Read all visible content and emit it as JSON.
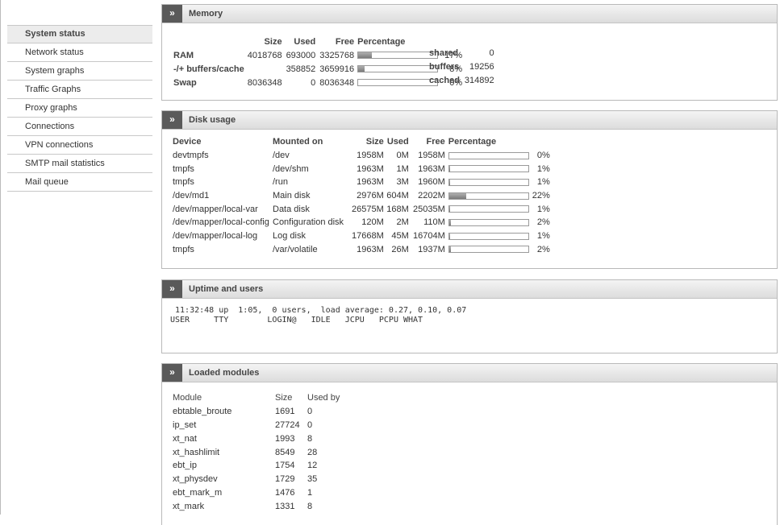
{
  "sidebar": {
    "items": [
      {
        "label": "System status"
      },
      {
        "label": "Network status"
      },
      {
        "label": "System graphs"
      },
      {
        "label": "Traffic Graphs"
      },
      {
        "label": "Proxy graphs"
      },
      {
        "label": "Connections"
      },
      {
        "label": "VPN connections"
      },
      {
        "label": "SMTP mail statistics"
      },
      {
        "label": "Mail queue"
      }
    ]
  },
  "toggle_glyph": "»",
  "memory": {
    "title": "Memory",
    "headers": {
      "size": "Size",
      "used": "Used",
      "free": "Free",
      "pct": "Percentage"
    },
    "rows": [
      {
        "label": "RAM",
        "size": "4018768",
        "used": "693000",
        "free": "3325768",
        "pct": "17%",
        "fraction": 0.17
      },
      {
        "label": "-/+ buffers/cache",
        "size": "",
        "used": "358852",
        "free": "3659916",
        "pct": "8%",
        "fraction": 0.08
      },
      {
        "label": "Swap",
        "size": "8036348",
        "used": "0",
        "free": "8036348",
        "pct": "0%",
        "fraction": 0.0
      }
    ],
    "extra": [
      {
        "label": "shared",
        "value": "0"
      },
      {
        "label": "buffers",
        "value": "19256"
      },
      {
        "label": "cached",
        "value": "314892"
      }
    ]
  },
  "disk": {
    "title": "Disk usage",
    "headers": {
      "device": "Device",
      "mounted": "Mounted on",
      "size": "Size",
      "used": "Used",
      "free": "Free",
      "pct": "Percentage"
    },
    "rows": [
      {
        "device": "devtmpfs",
        "mounted": "/dev",
        "size": "1958M",
        "used": "0M",
        "free": "1958M",
        "pct": "0%",
        "fraction": 0.0
      },
      {
        "device": "tmpfs",
        "mounted": "/dev/shm",
        "size": "1963M",
        "used": "1M",
        "free": "1963M",
        "pct": "1%",
        "fraction": 0.01
      },
      {
        "device": "tmpfs",
        "mounted": "/run",
        "size": "1963M",
        "used": "3M",
        "free": "1960M",
        "pct": "1%",
        "fraction": 0.01
      },
      {
        "device": "/dev/md1",
        "mounted": "Main disk",
        "size": "2976M",
        "used": "604M",
        "free": "2202M",
        "pct": "22%",
        "fraction": 0.22
      },
      {
        "device": "/dev/mapper/local-var",
        "mounted": "Data disk",
        "size": "26575M",
        "used": "168M",
        "free": "25035M",
        "pct": "1%",
        "fraction": 0.01
      },
      {
        "device": "/dev/mapper/local-config",
        "mounted": "Configuration disk",
        "size": "120M",
        "used": "2M",
        "free": "110M",
        "pct": "2%",
        "fraction": 0.02
      },
      {
        "device": "/dev/mapper/local-log",
        "mounted": "Log disk",
        "size": "17668M",
        "used": "45M",
        "free": "16704M",
        "pct": "1%",
        "fraction": 0.01
      },
      {
        "device": "tmpfs",
        "mounted": "/var/volatile",
        "size": "1963M",
        "used": "26M",
        "free": "1937M",
        "pct": "2%",
        "fraction": 0.02
      }
    ]
  },
  "uptime": {
    "title": "Uptime and users",
    "text": " 11:32:48 up  1:05,  0 users,  load average: 0.27, 0.10, 0.07\nUSER     TTY        LOGIN@   IDLE   JCPU   PCPU WHAT"
  },
  "modules": {
    "title": "Loaded modules",
    "headers": {
      "module": "Module",
      "size": "Size",
      "used_by": "Used by"
    },
    "rows": [
      {
        "module": "ebtable_broute",
        "size": "1691",
        "used_by": "0"
      },
      {
        "module": "ip_set",
        "size": "27724",
        "used_by": "0"
      },
      {
        "module": "xt_nat",
        "size": "1993",
        "used_by": "8"
      },
      {
        "module": "xt_hashlimit",
        "size": "8549",
        "used_by": "28"
      },
      {
        "module": "ebt_ip",
        "size": "1754",
        "used_by": "12"
      },
      {
        "module": "xt_physdev",
        "size": "1729",
        "used_by": "35"
      },
      {
        "module": "ebt_mark_m",
        "size": "1476",
        "used_by": "1"
      },
      {
        "module": "xt_mark",
        "size": "1331",
        "used_by": "8"
      }
    ]
  }
}
